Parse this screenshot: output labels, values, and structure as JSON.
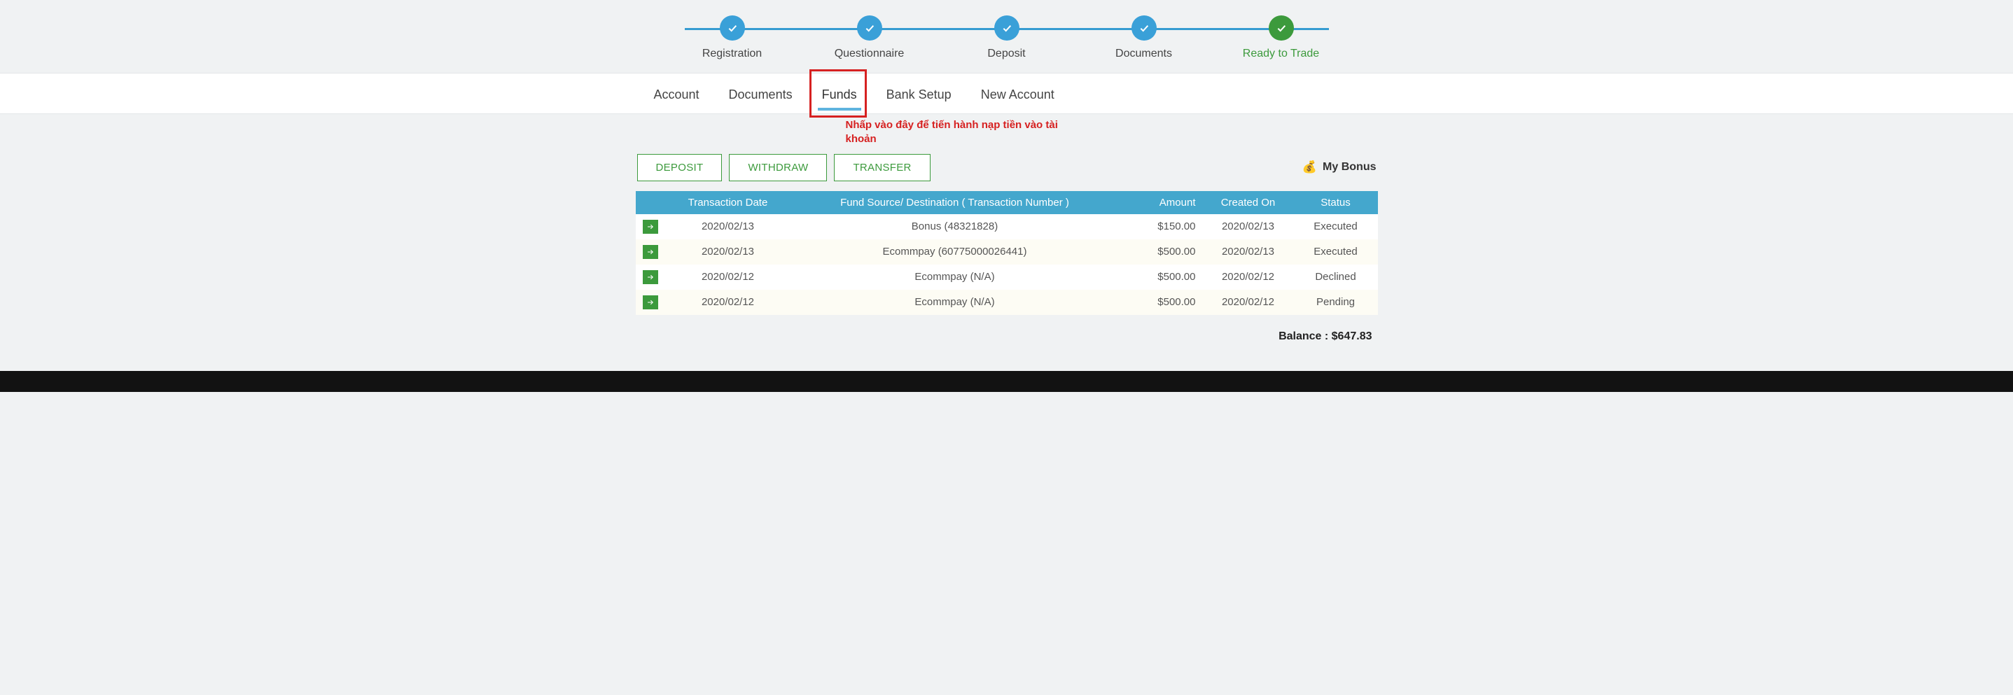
{
  "colors": {
    "accent_blue": "#3aa0d8",
    "accent_green": "#3c9a3c",
    "annotation_red": "#d62121"
  },
  "stepper": {
    "steps": [
      {
        "label": "Registration",
        "complete": true
      },
      {
        "label": "Questionnaire",
        "complete": true
      },
      {
        "label": "Deposit",
        "complete": true
      },
      {
        "label": "Documents",
        "complete": true
      },
      {
        "label": "Ready to Trade",
        "complete": true,
        "final": true
      }
    ]
  },
  "nav": {
    "tabs": [
      {
        "label": "Account"
      },
      {
        "label": "Documents"
      },
      {
        "label": "Funds",
        "active": true
      },
      {
        "label": "Bank Setup"
      },
      {
        "label": "New Account"
      }
    ],
    "annotation": "Nhấp vào đây để tiến hành nạp tiền vào tài khoản"
  },
  "actions": {
    "deposit": "DEPOSIT",
    "withdraw": "WITHDRAW",
    "transfer": "TRANSFER",
    "bonus_label": "My Bonus"
  },
  "table": {
    "headers": {
      "date": "Transaction Date",
      "source": "Fund Source/ Destination ( Transaction Number )",
      "amount": "Amount",
      "created": "Created On",
      "status": "Status"
    },
    "rows": [
      {
        "date": "2020/02/13",
        "source": "Bonus (48321828)",
        "amount": "$150.00",
        "created": "2020/02/13",
        "status": "Executed",
        "status_class": "executed"
      },
      {
        "date": "2020/02/13",
        "source": "Ecommpay (60775000026441)",
        "amount": "$500.00",
        "created": "2020/02/13",
        "status": "Executed",
        "status_class": "executed"
      },
      {
        "date": "2020/02/12",
        "source": "Ecommpay (N/A)",
        "amount": "$500.00",
        "created": "2020/02/12",
        "status": "Declined",
        "status_class": "declined"
      },
      {
        "date": "2020/02/12",
        "source": "Ecommpay (N/A)",
        "amount": "$500.00",
        "created": "2020/02/12",
        "status": "Pending",
        "status_class": "pending"
      }
    ]
  },
  "balance": {
    "label": "Balance : ",
    "value": "$647.83"
  }
}
